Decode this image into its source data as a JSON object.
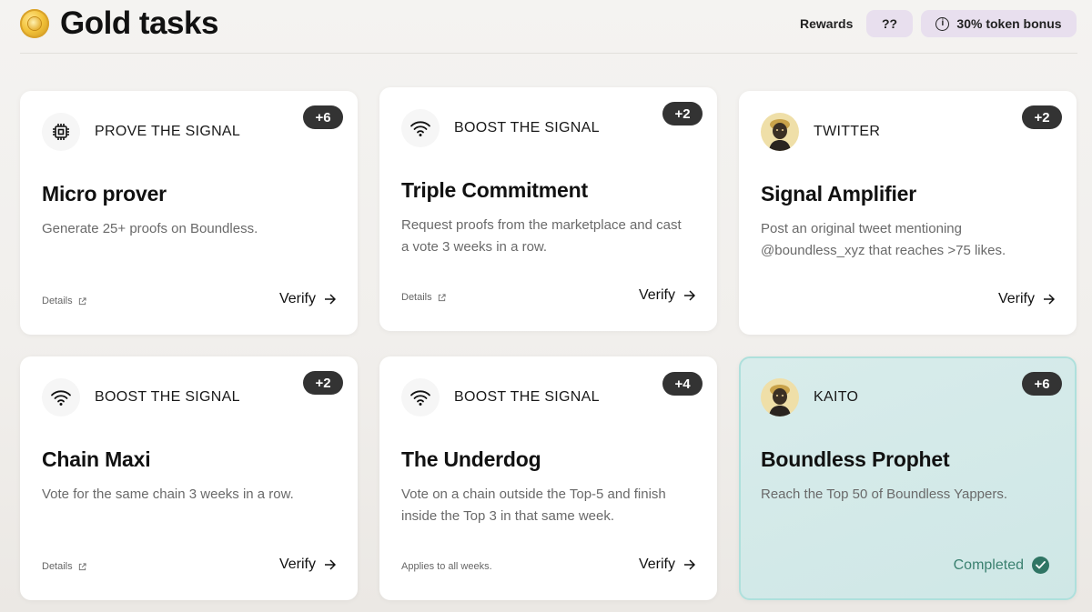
{
  "header": {
    "title": "Gold tasks",
    "rewards_label": "Rewards",
    "question_label": "??",
    "bonus_label": "30% token bonus",
    "info_icon_glyph": "i"
  },
  "colors": {
    "badge": "#333333",
    "pill": "#e8dfee",
    "completed_bg": "#d2e9e8",
    "completed_text": "#3b8170"
  },
  "cards": [
    {
      "points": "+6",
      "category": "PROVE THE SIGNAL",
      "icon": "chip-icon",
      "title": "Micro prover",
      "description": "Generate 25+ proofs on Boundless.",
      "footer_left": "Details",
      "action": "Verify"
    },
    {
      "points": "+2",
      "category": "BOOST THE SIGNAL",
      "icon": "signal-icon",
      "title": "Triple Commitment",
      "description": "Request proofs from the marketplace and cast a vote 3 weeks in a row.",
      "footer_left": "Details",
      "action": "Verify"
    },
    {
      "points": "+2",
      "category": "TWITTER",
      "icon": "avatar-icon",
      "title": "Signal Amplifier",
      "description": "Post an original tweet mentioning @boundless_xyz that reaches >75 likes.",
      "action": "Verify"
    },
    {
      "points": "+2",
      "category": "BOOST THE SIGNAL",
      "icon": "signal-icon",
      "title": "Chain Maxi",
      "description": "Vote for the same chain 3 weeks in a row.",
      "footer_left": "Details",
      "action": "Verify"
    },
    {
      "points": "+4",
      "category": "BOOST THE SIGNAL",
      "icon": "signal-icon",
      "title": "The Underdog",
      "description": "Vote on a chain outside the Top-5 and finish inside the Top 3 in that same week.",
      "footer_left": "Applies to all weeks.",
      "action": "Verify"
    },
    {
      "points": "+6",
      "category": "KAITO",
      "icon": "avatar-icon",
      "title": "Boundless Prophet",
      "description": "Reach the Top 50 of Boundless Yappers.",
      "status": "Completed"
    }
  ]
}
